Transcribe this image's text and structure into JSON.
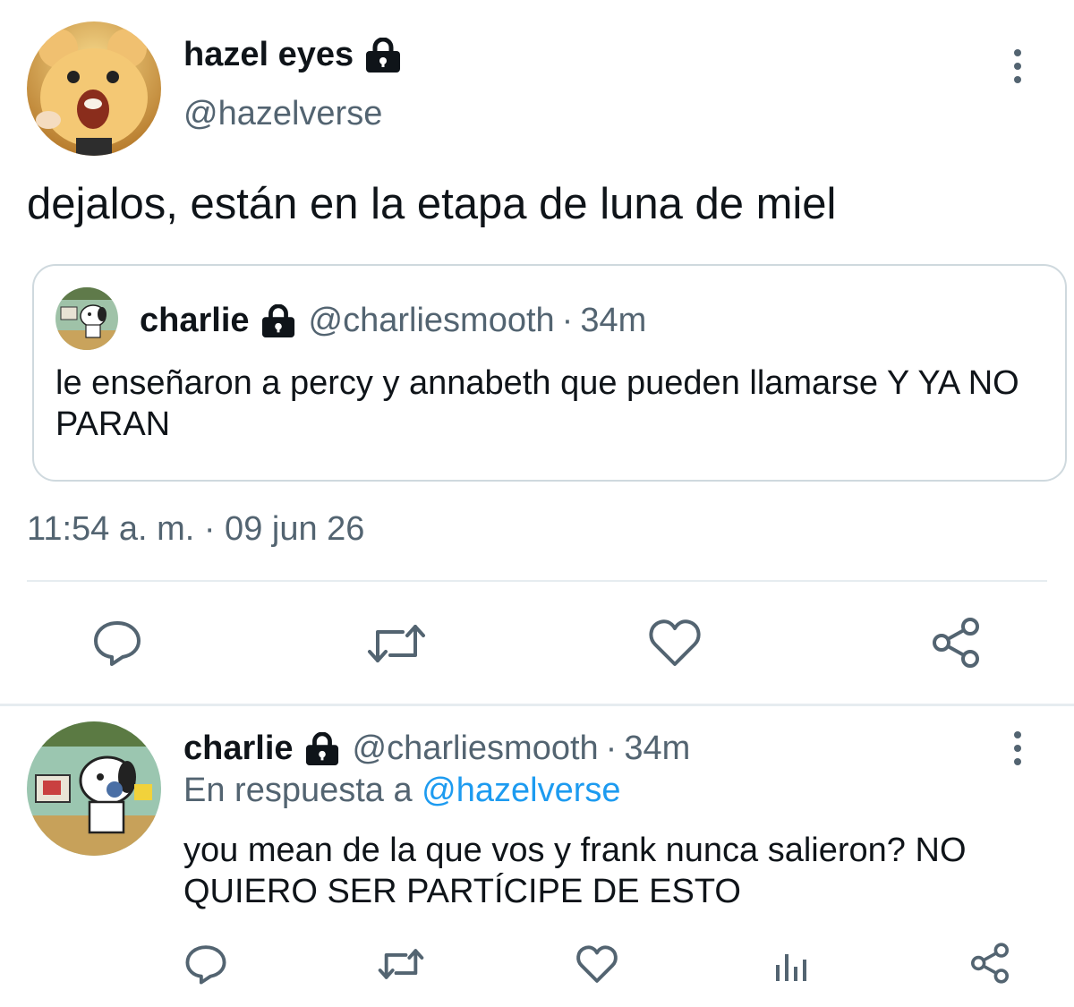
{
  "main_tweet": {
    "display_name": "hazel eyes",
    "handle": "@hazelverse",
    "text": "dejalos, están en la etapa de luna de miel",
    "timestamp": "11:54 a. m. · 09 jun 26",
    "protected": true
  },
  "quoted_tweet": {
    "display_name": "charlie",
    "handle": "@charliesmooth",
    "separator": "·",
    "time": "34m",
    "text": "le enseñaron a percy y annabeth que pueden llamarse Y YA NO PARAN",
    "protected": true
  },
  "reply_tweet": {
    "display_name": "charlie",
    "handle": "@charliesmooth",
    "separator": "·",
    "time": "34m",
    "reply_prefix": "En respuesta a",
    "reply_to": "@hazelverse",
    "text": "you mean de la que vos y frank nunca salieron? NO QUIERO SER PARTÍCIPE DE ESTO",
    "protected": true
  },
  "icons": {
    "more": "more-vertical-icon",
    "reply": "reply-icon",
    "retweet": "retweet-icon",
    "like": "like-icon",
    "share": "share-icon",
    "analytics": "analytics-icon",
    "lock": "lock-icon"
  },
  "colors": {
    "text": "#0f1419",
    "muted": "#536471",
    "link": "#1d9bf0",
    "border": "#cfd9de"
  }
}
